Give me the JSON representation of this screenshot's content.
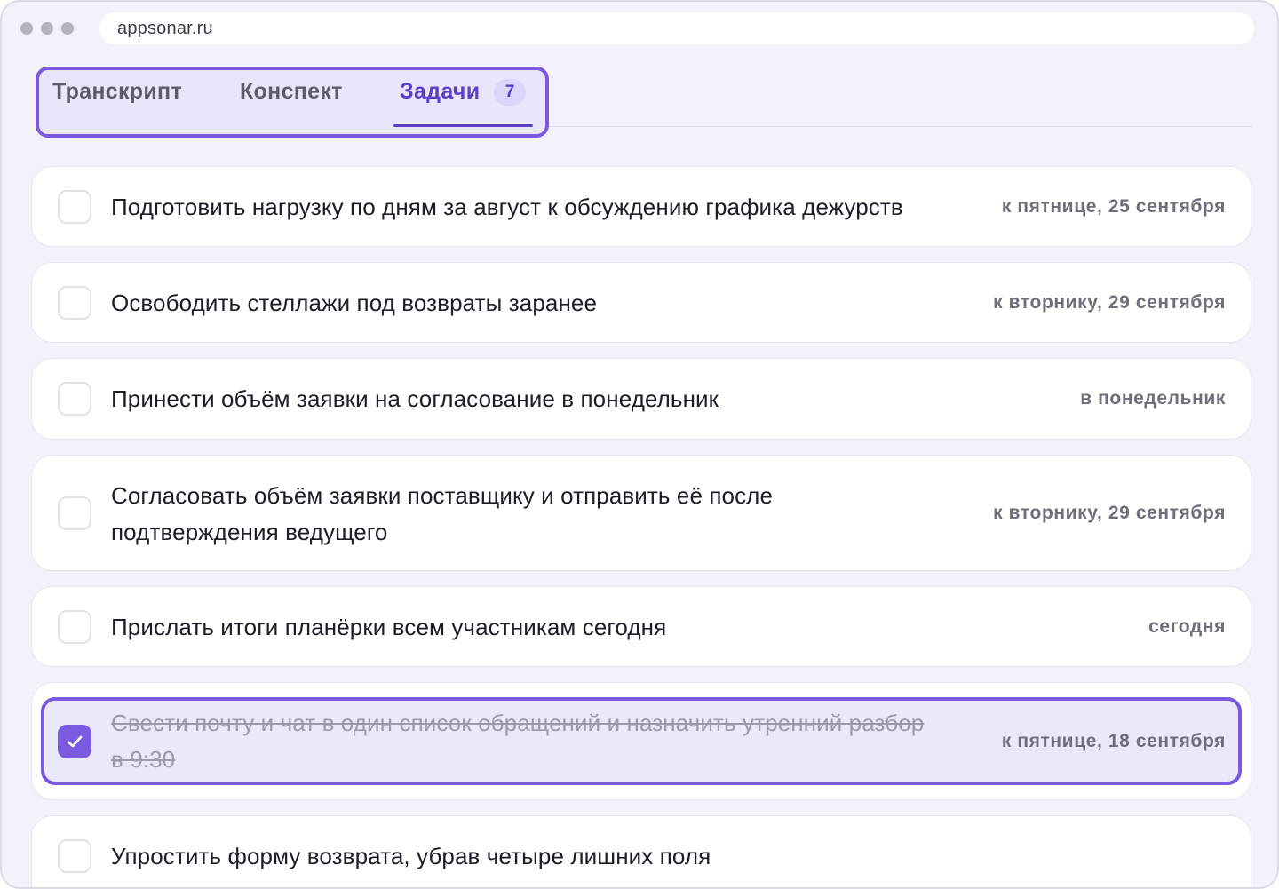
{
  "browser": {
    "url": "appsonar.ru"
  },
  "tabs": [
    {
      "label": "Транскрипт"
    },
    {
      "label": "Конспект"
    },
    {
      "label": "Задачи",
      "badge": "7"
    }
  ],
  "tasks": [
    {
      "text": "Подготовить нагрузку по дням за август к обсуждению графика дежурств",
      "due": "к пятнице, 25 сентября",
      "done": false
    },
    {
      "text": "Освободить стеллажи под возвраты заранее",
      "due": "к вторнику, 29 сентября",
      "done": false
    },
    {
      "text": "Принести объём заявки на согласование в понедельник",
      "due": "в понедельник",
      "done": false
    },
    {
      "line1": "Согласовать объём заявки поставщику и отправить её после",
      "line2": "подтверждения ведущего",
      "due": "к вторнику, 29 сентября",
      "done": false
    },
    {
      "text": "Прислать итоги планёрки всем участникам сегодня",
      "due": "сегодня",
      "done": false
    },
    {
      "line1": "Свести почту и чат в один список обращений и назначить утренний разбор",
      "line2": "в 9:30",
      "due": "к пятнице, 18 сентября",
      "done": true
    },
    {
      "text": "Упростить форму возврата, убрав четыре лишних поля",
      "due": "",
      "done": false
    }
  ],
  "colors": {
    "accent": "#7a5be0",
    "accent_text": "#5a3ec8",
    "background": "#f3f2fb",
    "card": "#ffffff",
    "due_text": "#6f6e7b"
  }
}
